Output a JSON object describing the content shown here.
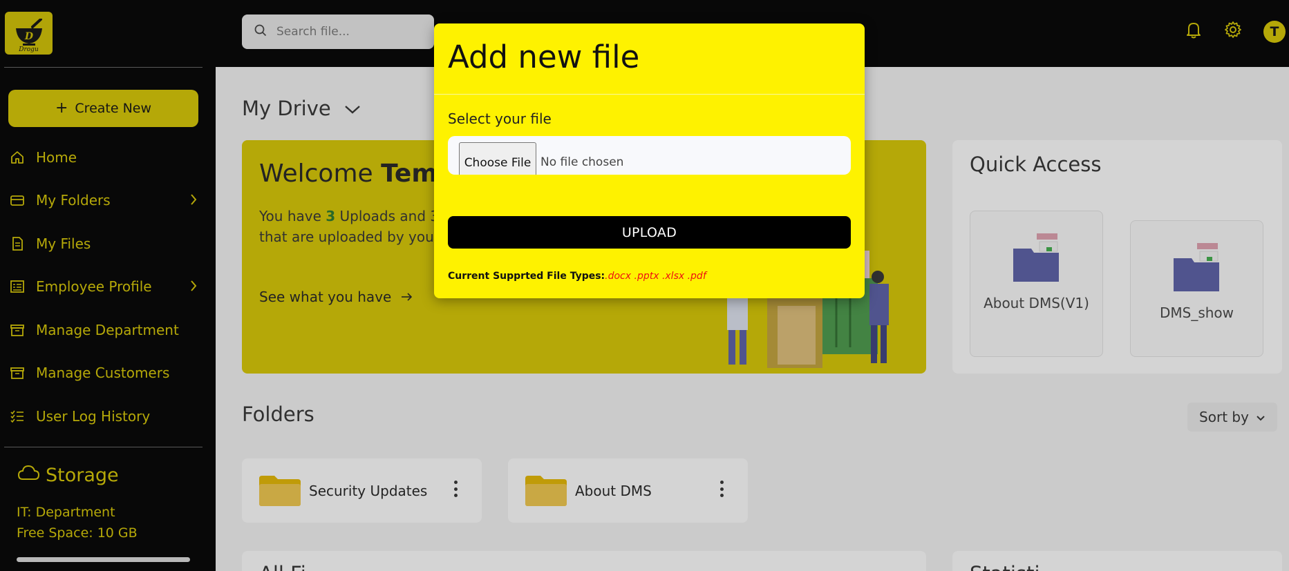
{
  "sidebar": {
    "logo_text": "Drogu",
    "create_label": "Create New",
    "items": [
      {
        "label": "Home",
        "icon": "home-icon",
        "has_chevron": false
      },
      {
        "label": "My Folders",
        "icon": "folder-icon",
        "has_chevron": true
      },
      {
        "label": "My Files",
        "icon": "file-icon",
        "has_chevron": false
      },
      {
        "label": "Employee Profile",
        "icon": "profile-icon",
        "has_chevron": true
      },
      {
        "label": "Manage Department",
        "icon": "archive-icon",
        "has_chevron": false
      },
      {
        "label": "Manage Customers",
        "icon": "archive-icon",
        "has_chevron": false
      },
      {
        "label": "User Log History",
        "icon": "checklist-icon",
        "has_chevron": false
      }
    ],
    "storage": {
      "title": "Storage",
      "department": "IT: Department",
      "free_space": "Free Space: 10 GB"
    }
  },
  "topbar": {
    "search_placeholder": "Search file...",
    "avatar_initial": "T"
  },
  "main": {
    "drive_title": "My Drive",
    "welcome": {
      "greeting": "Welcome ",
      "name": "Tem",
      "text_before": "You have ",
      "uploads_count": "3",
      "text_mid": " Uploads and 3",
      "text_line2": "that are uploaded by you",
      "see_link": "See what you have"
    },
    "quick_access": {
      "title": "Quick Access",
      "items": [
        "About DMS(V1)",
        "DMS_show"
      ]
    },
    "folders_title": "Folders",
    "sort_label": "Sort by",
    "folders": [
      "Security Updates",
      "About DMS"
    ],
    "bottom_left_title": "All Fi",
    "bottom_right_title": "Statisti"
  },
  "modal": {
    "title": "Add new file",
    "select_label": "Select your file",
    "choose_button": "Choose File",
    "no_file_text": "No file chosen",
    "upload_button": "UPLOAD",
    "types_label": "Current Supprted File Types:",
    "types_value": ".docx .pptx .xlsx .pdf"
  },
  "colors": {
    "accent": "#d9c800",
    "modal_bg": "#fef200",
    "types_red": "#e11111"
  }
}
